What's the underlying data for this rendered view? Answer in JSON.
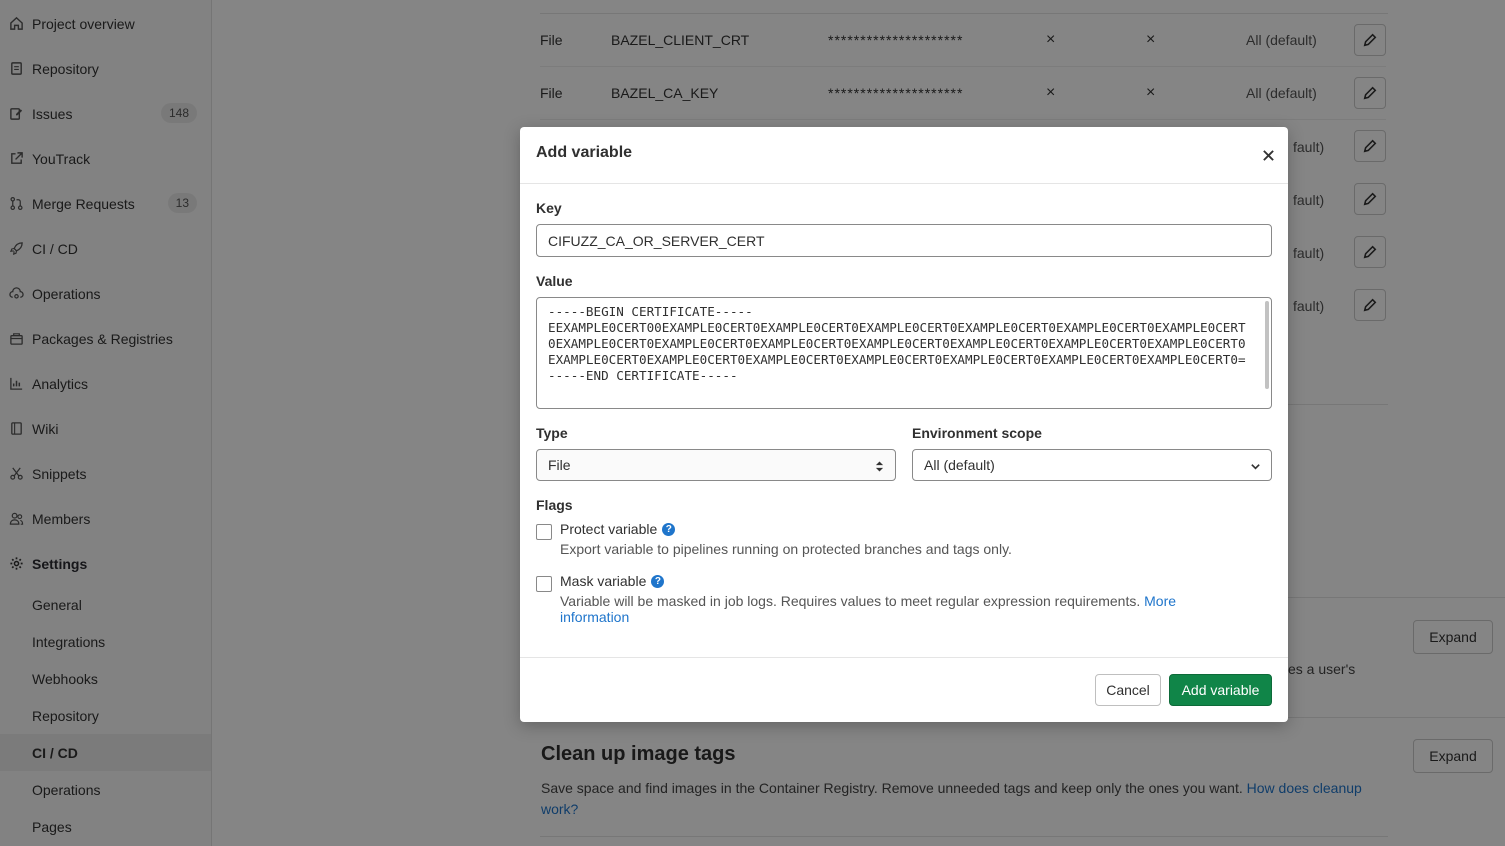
{
  "sidebar": {
    "items": [
      {
        "label": "Project overview",
        "icon": "home-icon"
      },
      {
        "label": "Repository",
        "icon": "doc-icon"
      },
      {
        "label": "Issues",
        "icon": "issues-icon",
        "badge": "148"
      },
      {
        "label": "YouTrack",
        "icon": "external-link-icon"
      },
      {
        "label": "Merge Requests",
        "icon": "merge-request-icon",
        "badge": "13"
      },
      {
        "label": "CI / CD",
        "icon": "rocket-icon"
      },
      {
        "label": "Operations",
        "icon": "cloud-gear-icon"
      },
      {
        "label": "Packages & Registries",
        "icon": "package-icon"
      },
      {
        "label": "Analytics",
        "icon": "chart-icon"
      },
      {
        "label": "Wiki",
        "icon": "book-icon"
      },
      {
        "label": "Snippets",
        "icon": "scissors-icon"
      },
      {
        "label": "Members",
        "icon": "users-icon"
      },
      {
        "label": "Settings",
        "icon": "gear-icon"
      }
    ],
    "settings_sub": [
      "General",
      "Integrations",
      "Webhooks",
      "Repository",
      "CI / CD",
      "Operations",
      "Pages"
    ]
  },
  "background": {
    "rows": [
      {
        "type": "File",
        "key": "BAZEL_CLIENT_CRT",
        "value": "*********************",
        "protected": "×",
        "masked": "×",
        "env": "All (default)"
      },
      {
        "type": "File",
        "key": "BAZEL_CA_KEY",
        "value": "*********************",
        "protected": "×",
        "masked": "×",
        "env": "All (default)"
      }
    ],
    "partial_env": "fault)",
    "partial_text": "es a user's",
    "expand_label": "Expand",
    "cleanup": {
      "title": "Clean up image tags",
      "desc": "Save space and find images in the Container Registry. Remove unneeded tags and keep only the ones you want.",
      "link": "How does cleanup work?"
    }
  },
  "modal": {
    "title": "Add variable",
    "key_label": "Key",
    "key_value": "CIFUZZ_CA_OR_SERVER_CERT",
    "value_label": "Value",
    "value_text": "-----BEGIN CERTIFICATE-----\nEEXAMPLE0CERT00EXAMPLE0CERT0EXAMPLE0CERT0EXAMPLE0CERT0EXAMPLE0CERT0EXAMPLE0CERT0EXAMPLE0CERT0EXAMPLE0CERT0EXAMPLE0CERT0EXAMPLE0CERT0EXAMPLE0CERT0EXAMPLE0CERT0EXAMPLE0CERT0EXAMPLE0CERT0EXAMPLE0CERT0EXAMPLE0CERT0EXAMPLE0CERT0EXAMPLE0CERT0EXAMPLE0CERT0EXAMPLE0CERT0EXAMPLE0CERT0=\n-----END CERTIFICATE-----",
    "type_label": "Type",
    "type_value": "File",
    "env_label": "Environment scope",
    "env_value": "All (default)",
    "flags_label": "Flags",
    "protect_label": "Protect variable",
    "protect_help": "Export variable to pipelines running on protected branches and tags only.",
    "mask_label": "Mask variable",
    "mask_help": "Variable will be masked in job logs. Requires values to meet regular expression requirements.",
    "mask_link": "More information",
    "cancel_label": "Cancel",
    "add_label": "Add variable"
  }
}
